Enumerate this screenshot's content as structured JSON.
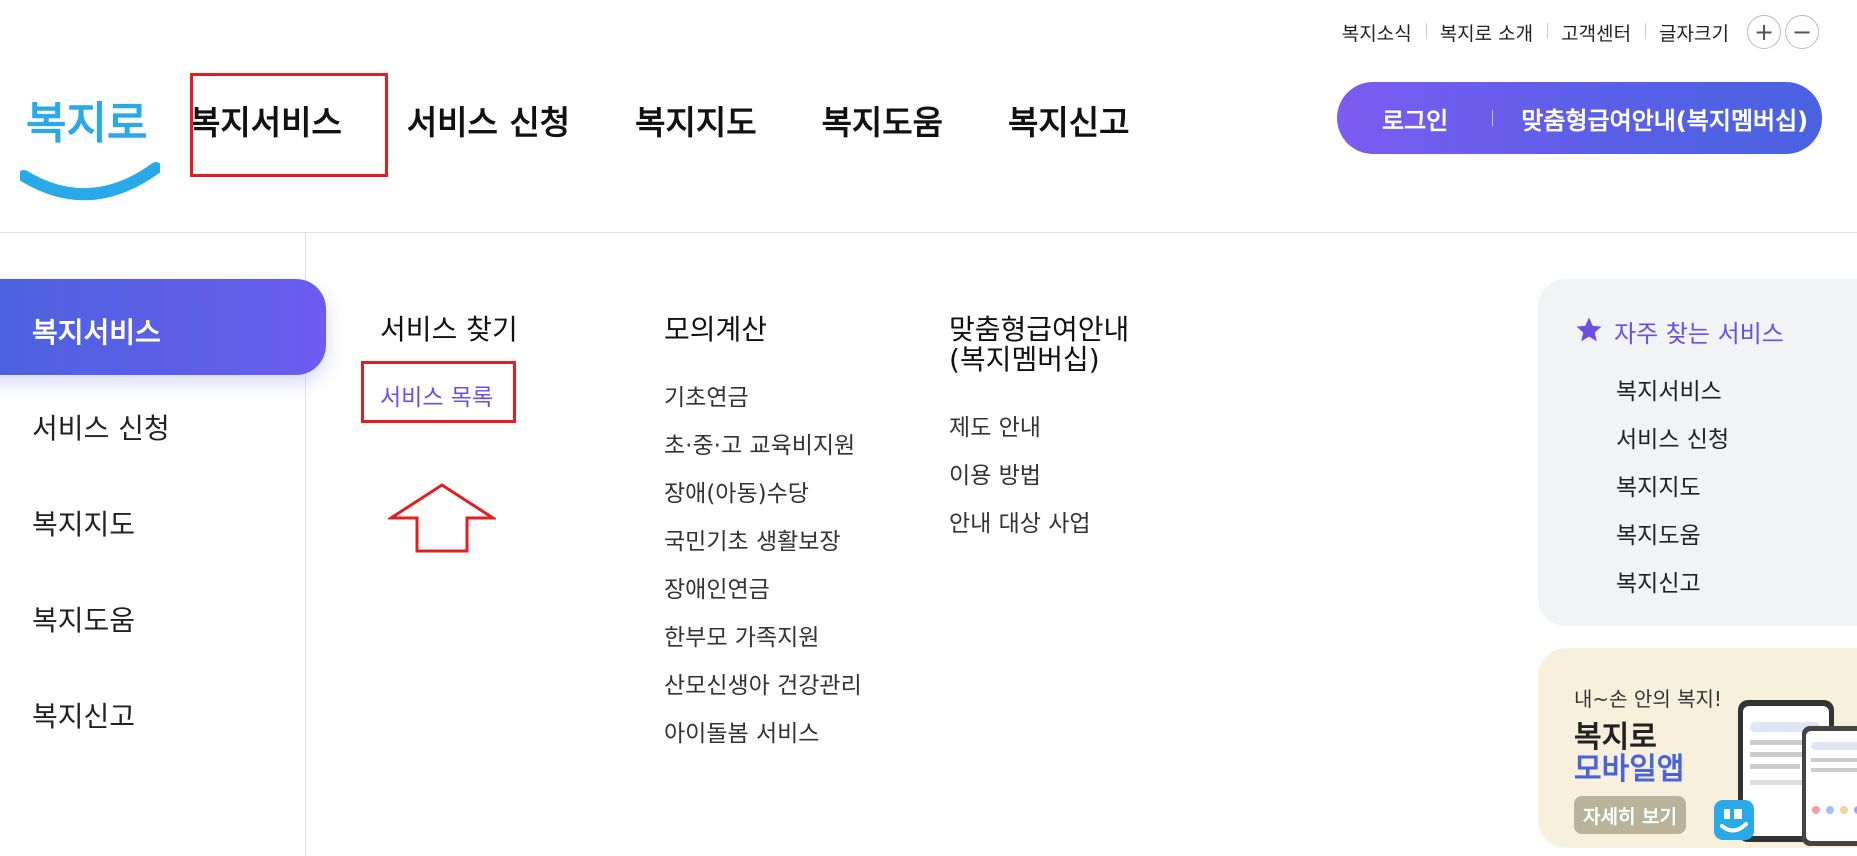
{
  "utility": {
    "items": [
      "복지소식",
      "복지로 소개",
      "고객센터",
      "글자크기"
    ],
    "zoom_in": "+",
    "zoom_out": "−"
  },
  "logo": {
    "text": "복지로"
  },
  "nav": {
    "items": [
      "복지서비스",
      "서비스 신청",
      "복지지도",
      "복지도움",
      "복지신고"
    ]
  },
  "account": {
    "login": "로그인",
    "membership": "맞춤형급여안내(복지멤버십)"
  },
  "side_menu": {
    "items": [
      "복지서비스",
      "서비스 신청",
      "복지지도",
      "복지도움",
      "복지신고"
    ],
    "active": "복지서비스"
  },
  "columns": [
    {
      "heading": "서비스 찾기",
      "links": [
        "서비스 목록"
      ]
    },
    {
      "heading": "모의계산",
      "links": [
        "기초연금",
        "초·중·고 교육비지원",
        "장애(아동)수당",
        "국민기초 생활보장",
        "장애인연금",
        "한부모 가족지원",
        "산모신생아 건강관리",
        "아이돌봄 서비스"
      ]
    },
    {
      "heading_line1": "맞춤형급여안내",
      "heading_line2": "(복지멤버십)",
      "links": [
        "제도 안내",
        "이용 방법",
        "안내 대상 사업"
      ]
    }
  ],
  "favorites": {
    "title": "자주 찾는 서비스",
    "items": [
      "복지서비스",
      "서비스 신청",
      "복지지도",
      "복지도움",
      "복지신고"
    ]
  },
  "banner": {
    "subtitle": "내~손 안의 복지!",
    "title_line1": "복지로",
    "title_line2": "모바일앱",
    "button": "자세히 보기"
  },
  "colors": {
    "accent": "#6a4fe0",
    "gradient_start": "#4a63dc",
    "gradient_end": "#7b5cf0",
    "logo_blue": "#2aa9e8",
    "annotation_red": "#e02020",
    "banner_bg": "#f7f0dc"
  }
}
